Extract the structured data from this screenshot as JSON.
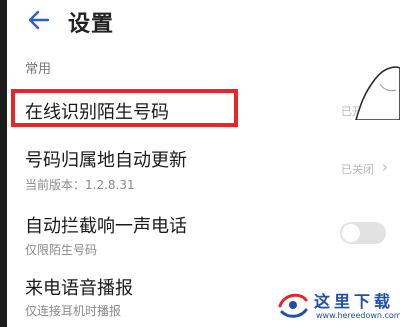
{
  "header": {
    "title": "设置"
  },
  "section": {
    "label": "常用"
  },
  "rows": [
    {
      "title": "在线识别陌生号码",
      "status": "已开启"
    },
    {
      "title": "号码归属地自动更新",
      "subtitle": "当前版本：1.2.8.31",
      "status": "已关闭"
    },
    {
      "title": "自动拦截响一声电话",
      "subtitle": "仅限陌生号码",
      "toggle_on": false
    },
    {
      "title": "来电语音播报",
      "subtitle": "仅连接耳机时播报"
    }
  ],
  "watermark": {
    "title": "这里下载",
    "url": "www.hereedown.com"
  },
  "colors": {
    "highlight": "#e8262a",
    "back_arrow": "#2a5fc8",
    "watermark": "#1f4fa8"
  }
}
